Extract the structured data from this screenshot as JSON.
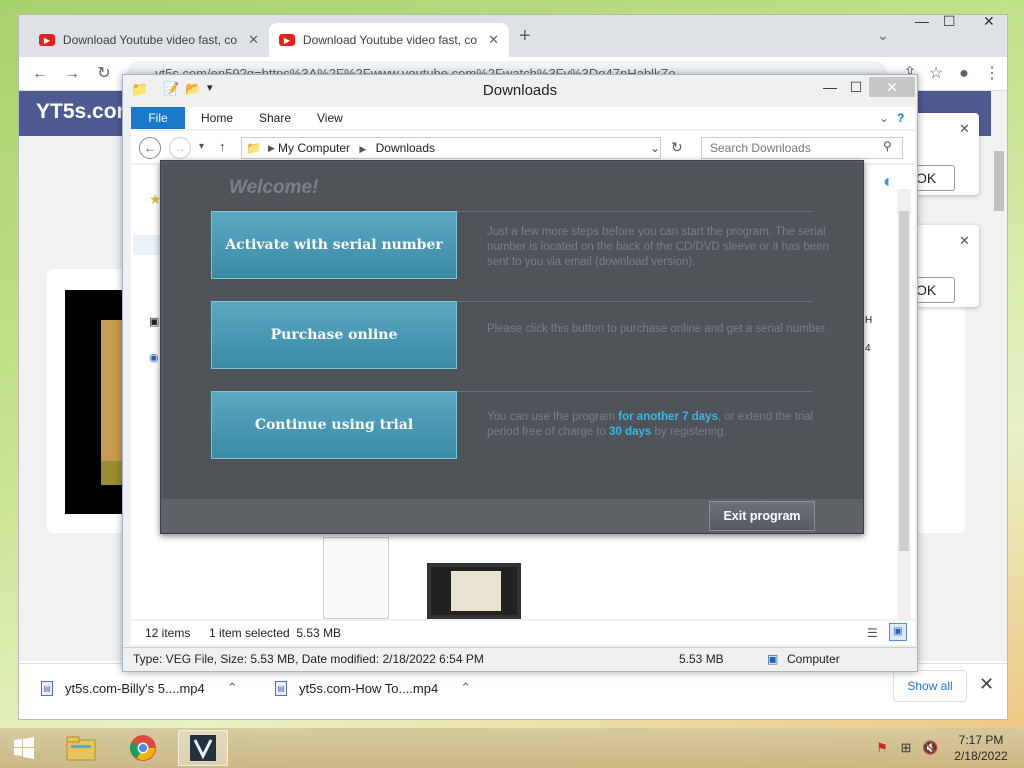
{
  "browser": {
    "tabs": [
      {
        "title": "Download Youtube video fast, co",
        "active": false
      },
      {
        "title": "Download Youtube video fast, co",
        "active": true
      }
    ],
    "new_tab": "+",
    "tab_search": "⌄",
    "window_controls": {
      "minimize": "—",
      "maximize": "☐",
      "close": "✕"
    },
    "address": "yt5s.com/en59?q=https%3A%2F%2Fwww.youtube.com%2Fwatch%3Fv%3Dq47nHablkZo",
    "nav": {
      "back": "←",
      "forward": "→",
      "reload": "↻"
    }
  },
  "page": {
    "logo": "YT5s.com",
    "ok_label": "OK"
  },
  "downloads_bar": {
    "items": [
      {
        "name": "yt5s.com-Billy's 5....mp4"
      },
      {
        "name": "yt5s.com-How To....mp4"
      }
    ],
    "show_all": "Show all",
    "close": "✕"
  },
  "explorer": {
    "title": "Downloads",
    "ribbon_tabs": [
      "File",
      "Home",
      "Share",
      "View"
    ],
    "breadcrumb": [
      "My Computer",
      "Downloads"
    ],
    "search_placeholder": "Search Downloads",
    "status": {
      "items": "12 items",
      "selected": "1 item selected  5.53 MB"
    },
    "details": {
      "info": "Type: VEG File, Size: 5.53 MB, Date modified: 2/18/2022 6:54 PM",
      "size": "5.53 MB",
      "location": "Computer"
    }
  },
  "dialog": {
    "welcome": "Welcome!",
    "options": [
      {
        "button": "Activate with serial number",
        "description": "Just a few more steps before you can start the program. The serial number is located on the back of the CD/DVD sleeve or it has been sent to you via email (download version)."
      },
      {
        "button": "Purchase online",
        "description": "Please click this button to purchase online and get a serial number."
      },
      {
        "button": "Continue using trial",
        "desc_pre": "You can use the program ",
        "desc_hl1": "for another 7 days",
        "desc_mid": ", or extend the trial period free of charge to ",
        "desc_hl2": "30 days",
        "desc_post": " by registering."
      }
    ],
    "exit": "Exit program"
  },
  "taskbar": {
    "time": "7:17 PM",
    "date": "2/18/2022"
  },
  "colors": {
    "accent_blue": "#1979ca",
    "button_teal": "#4a9bb7",
    "highlight": "#37b7e6",
    "yt5s_header": "#4e5b93"
  }
}
